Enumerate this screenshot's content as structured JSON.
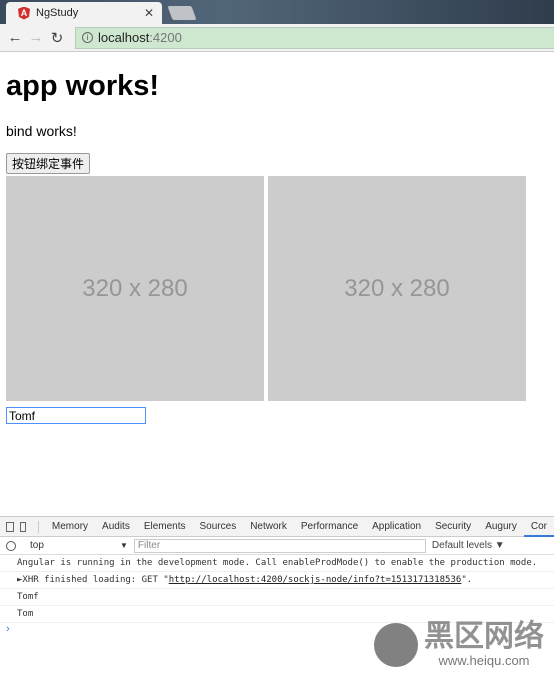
{
  "browser": {
    "tab_title": "NgStudy",
    "tab_icon": "angular-icon",
    "url_host": "localhost",
    "url_port": ":4200"
  },
  "page": {
    "heading": "app works!",
    "bind_text": "bind works!",
    "button_label": "按钮绑定事件",
    "images": [
      "320 x 280",
      "320 x 280"
    ],
    "input_value": "Tomf"
  },
  "devtools": {
    "tabs": [
      "Memory",
      "Audits",
      "Elements",
      "Sources",
      "Network",
      "Performance",
      "Application",
      "Security",
      "Augury",
      "Cor"
    ],
    "context": "top",
    "filter_placeholder": "Filter",
    "levels": "Default levels ▼",
    "logs": {
      "l0": "Angular is running in the development mode. Call enableProdMode() to enable the production mode.",
      "l1_prefix": "►XHR finished loading: GET \"",
      "l1_link": "http://localhost:4200/sockjs-node/info?t=1513171318536",
      "l1_suffix": "\".",
      "l2": "Tomf",
      "l3": "Tom"
    },
    "prompt": "›"
  },
  "watermark": {
    "text": "黑区网络",
    "url": "www.heiqu.com"
  }
}
